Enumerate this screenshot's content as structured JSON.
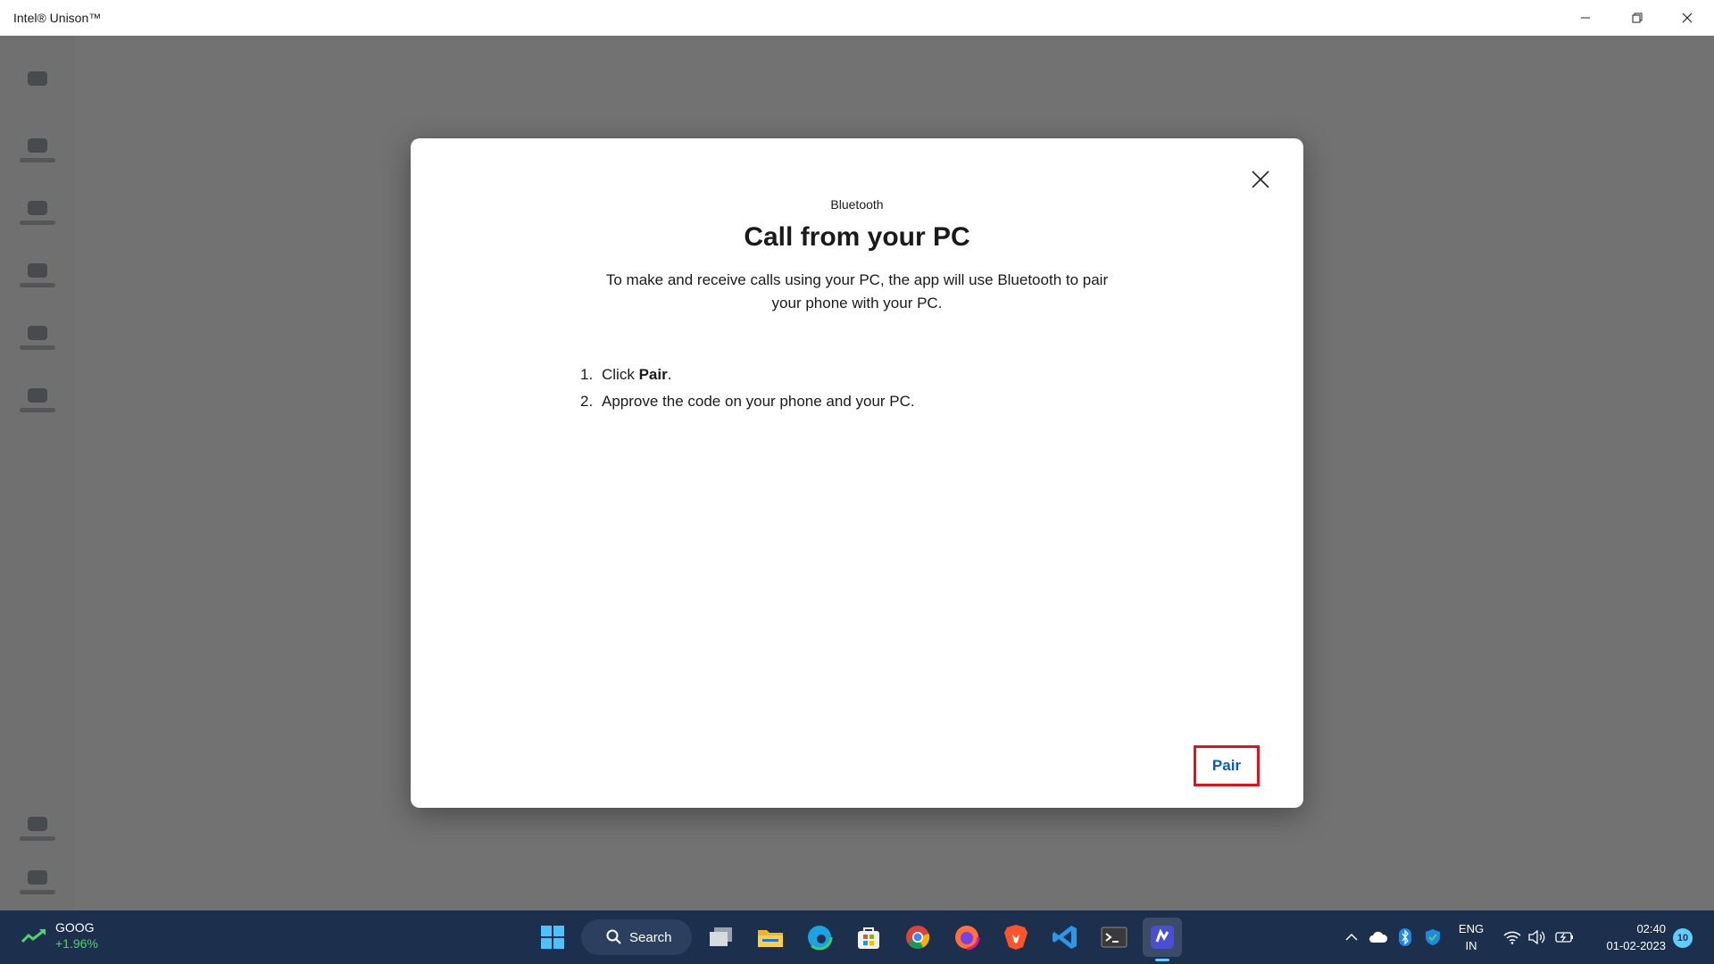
{
  "window": {
    "title": "Intel® Unison™"
  },
  "dialog": {
    "kicker": "Bluetooth",
    "title": "Call from your PC",
    "description": "To make and receive calls using your PC, the app will use Bluetooth to pair your phone with your PC.",
    "steps": [
      {
        "number": "1.",
        "before": "Click ",
        "bold": "Pair",
        "after": "."
      },
      {
        "number": "2.",
        "text": "Approve the code on your phone and your PC."
      }
    ],
    "pair_label": "Pair"
  },
  "taskbar": {
    "stock": {
      "symbol": "GOOG",
      "change": "+1.96%"
    },
    "search_label": "Search",
    "apps": [
      "windows-start-icon",
      "search-icon",
      "task-view-icon",
      "file-explorer-icon",
      "edge-icon",
      "microsoft-store-icon",
      "chrome-icon",
      "firefox-icon",
      "brave-icon",
      "vscode-icon",
      "terminal-icon",
      "intel-unison-icon"
    ],
    "tray": {
      "lang_line1": "ENG",
      "lang_line2": "IN",
      "time": "02:40",
      "date": "01-02-2023",
      "notifications": "10"
    }
  },
  "colors": {
    "accent": "#0a5bbd",
    "highlight": "#e2131e",
    "taskbar": "#1c2f4d"
  }
}
